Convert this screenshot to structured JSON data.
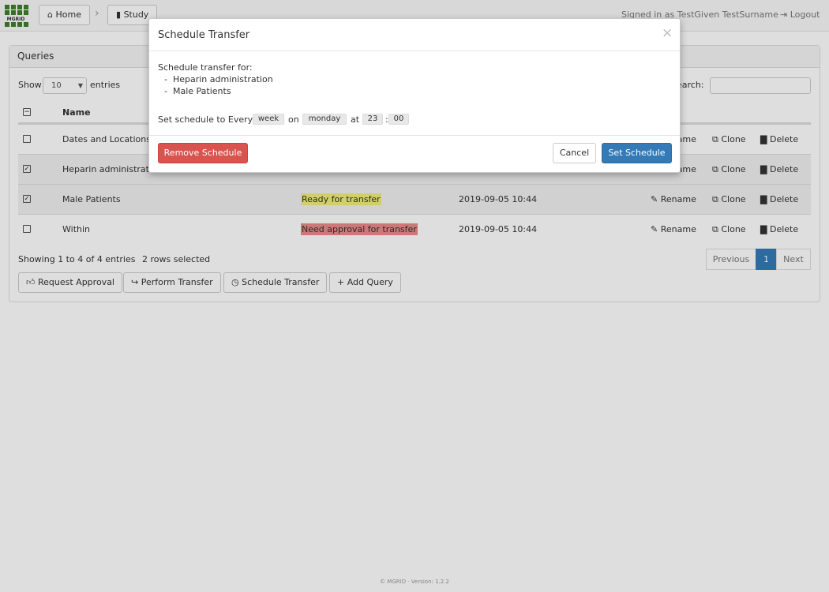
{
  "navbar": {
    "logo_text": "MGRID",
    "home_label": "Home",
    "study_label": "Study",
    "signed_in": "Signed in as TestGiven TestSurname",
    "logout_label": "Logout"
  },
  "panel": {
    "title": "Queries",
    "show_label": "Show",
    "page_size": "10",
    "entries_label": "entries",
    "search_label": "Search:",
    "columns": [
      "Name"
    ],
    "rows": [
      {
        "name": "Dates and Locations",
        "status": "",
        "date": "",
        "selected": false
      },
      {
        "name": "Heparin administration",
        "status": "",
        "date": "",
        "selected": true
      },
      {
        "name": "Male Patients",
        "status": "Ready for transfer",
        "date": "2019-09-05 10:44",
        "selected": true
      },
      {
        "name": "Within",
        "status": "Need approval for transfer",
        "date": "2019-09-05 10:44",
        "selected": false
      }
    ],
    "row_actions": {
      "rename": "Rename",
      "clone": "Clone",
      "delete": "Delete"
    },
    "info": "Showing 1 to 4 of 4 entries",
    "selected_info": "2 rows selected",
    "pagination": {
      "previous": "Previous",
      "current": "1",
      "next": "Next"
    },
    "buttons": {
      "request_approval": "Request Approval",
      "perform_transfer": "Perform Transfer",
      "schedule_transfer": "Schedule Transfer",
      "add_query": "Add Query"
    }
  },
  "modal": {
    "title": "Schedule Transfer",
    "intro": "Schedule transfer for:",
    "items": [
      "Heparin administration",
      "Male Patients"
    ],
    "schedule_prefix": "Set schedule to Every",
    "period": "week",
    "on_label": "on",
    "day": "monday",
    "at_label": "at",
    "hour": "23",
    "colon": ":",
    "minute": "00",
    "remove_label": "Remove Schedule",
    "cancel_label": "Cancel",
    "set_label": "Set Schedule",
    "close_glyph": "×"
  },
  "footer": {
    "text": "© MGRID · Version: 1.2.2"
  },
  "colors": {
    "danger": "#d9534f",
    "primary": "#337ab7",
    "ready": "#f0ee7a",
    "need": "#e88a8a",
    "logo": "#3f7f2a"
  }
}
